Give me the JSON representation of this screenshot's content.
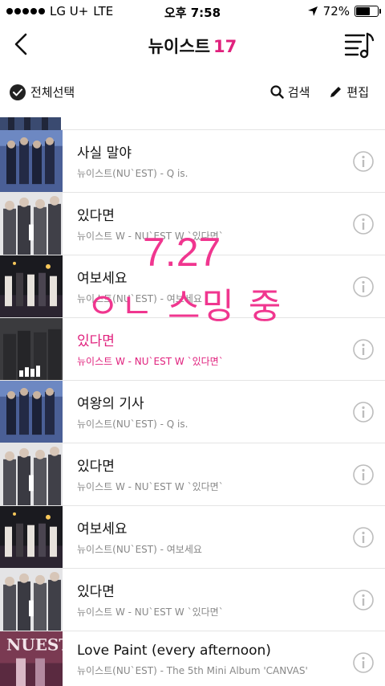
{
  "status": {
    "carrier": "LG U+",
    "network": "LTE",
    "time": "오후 7:58",
    "battery": "72%",
    "battery_level": 0.72
  },
  "nav": {
    "title": "뉴이스트",
    "count": "17"
  },
  "toolbar": {
    "select_all": "전체선택",
    "search": "검색",
    "edit": "편집"
  },
  "songs": [
    {
      "title": "사실 말야",
      "subtitle": "뉴이스트(NU`EST) - Q is.",
      "active": false,
      "art": "q"
    },
    {
      "title": "있다면",
      "subtitle": "뉴이스트 W - NU`EST W `있다면`",
      "active": false,
      "art": "w"
    },
    {
      "title": "여보세요",
      "subtitle": "뉴이스트(NU`EST) - 여보세요",
      "active": false,
      "art": "hello"
    },
    {
      "title": "있다면",
      "subtitle": "뉴이스트 W - NU`EST W `있다면`",
      "active": true,
      "art": "playing"
    },
    {
      "title": "여왕의 기사",
      "subtitle": "뉴이스트(NU`EST) - Q is.",
      "active": false,
      "art": "q"
    },
    {
      "title": "있다면",
      "subtitle": "뉴이스트 W - NU`EST W `있다면`",
      "active": false,
      "art": "w"
    },
    {
      "title": "여보세요",
      "subtitle": "뉴이스트(NU`EST) - 여보세요",
      "active": false,
      "art": "hello"
    },
    {
      "title": "있다면",
      "subtitle": "뉴이스트 W - NU`EST W `있다면`",
      "active": false,
      "art": "w"
    },
    {
      "title": "Love Paint (every afternoon)",
      "subtitle": "뉴이스트(NU`EST) - The 5th Mini Album 'CANVAS'",
      "active": false,
      "art": "canvas"
    }
  ],
  "overlay": {
    "line1": "7.27",
    "line2": "ㅇㄴ 스밍 중"
  },
  "colors": {
    "accent": "#e0217d",
    "overlay": "#f0368f"
  },
  "icons": {
    "back": "chevron-left-icon",
    "playlist": "playlist-icon",
    "search": "search-icon",
    "edit": "pencil-icon",
    "info": "info-icon",
    "check": "check-icon"
  }
}
